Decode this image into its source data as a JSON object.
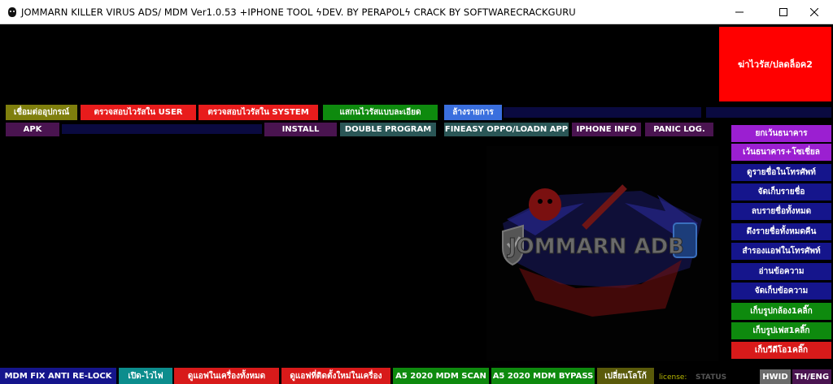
{
  "window": {
    "title": "JOMMARN KILLER VIRUS ADS/ MDM Ver1.0.53 +IPHONE TOOL ϟDEV. BY PERAPOLϟ CRACK BY SOFTWARECRACKGURU"
  },
  "big_button": {
    "label": "ฆ่าไวรัส/ปลดล็อค2"
  },
  "row1": {
    "connect": "เชื่อมต่ออุปกรณ์",
    "scan_user": "ตรวจสอบไวรัสใน USER",
    "scan_system": "ตรวจสอบไวรัสใน SYSTEM",
    "deep_scan": "แสกนไวรัสแบบละเอียด",
    "clear_list": "ล้างรายการ"
  },
  "row2": {
    "apk": "APK",
    "install": "INSTALL",
    "double_program": "DOUBLE PROGRAM",
    "fineasy": "FINEASY OPPO/LOADN APP",
    "iphone_info": "IPHONE INFO",
    "panic_log": "PANIC LOG."
  },
  "right_menu": [
    "ยกเว้นธนาคาร",
    "เว้นธนาคาร+โซเชี่ยล",
    "ดูรายชื่อในโทรศัพท์",
    "จัดเก็บรายชื่อ",
    "ลบรายชื่อทั้งหมด",
    "ดึงรายชื่อทั้งหมดคืน",
    "สำรองแอฟในโทรศัพท์",
    "อ่านข้อความ",
    "จัดเก็บข้อความ",
    "เก็บรูปกล้อง1คลิ๊ก",
    "เก็บรูปเฟส1คลิ๊ก",
    "เก็บวีดีโอ1คลิ๊ก"
  ],
  "bottom": {
    "mdm_fix": "MDM FIX ANTI RE-LOCK",
    "wifi": "เปิด-ไวไฟ",
    "all_apps": "ดูแอฟในเครื่องทั้งหมด",
    "new_apps": "ดูแอฟที่ติดตั้งใหม่ในเครื่อง",
    "a5_scan": "A5 2020 MDM SCAN",
    "a5_bypass": "A5 2020 MDM BYPASS",
    "change_logo": "เปลี่ยนโลโก้",
    "license_label": "license:",
    "status": "STATUS",
    "hwid": "HWID",
    "lang": "TH/ENG"
  },
  "logo": {
    "text": "JOMMARN ADB"
  },
  "colors": {
    "purple": "#9b1fd1",
    "navy": "#15158c",
    "green": "#0e8a0e",
    "red": "#d81a1a",
    "olive": "#7f7f0d",
    "dark_teal": "#1f4f4f",
    "dark_purple": "#4a1450",
    "blue": "#3a6fde",
    "teal": "#0c8d8d",
    "big_red": "#ff0000"
  }
}
